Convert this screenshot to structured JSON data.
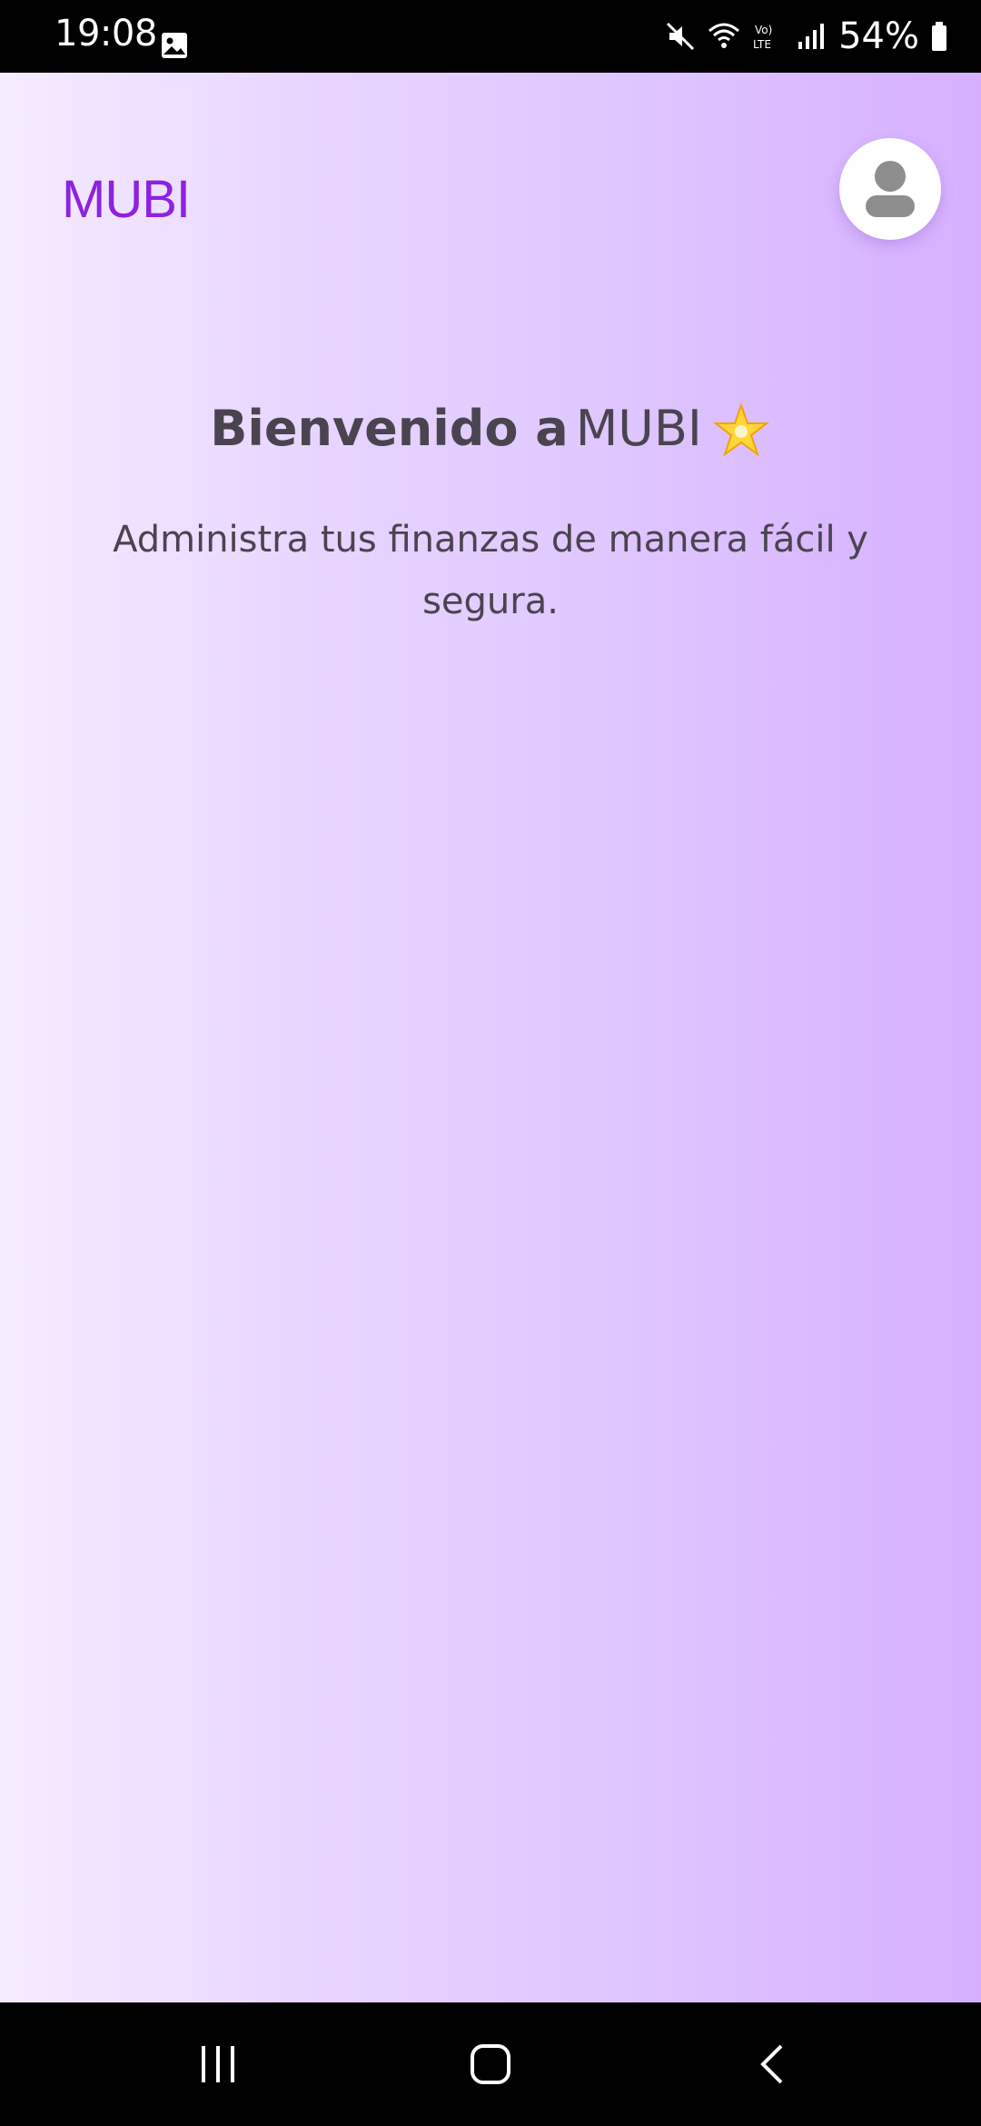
{
  "status_bar": {
    "time": "19:08",
    "battery": "54%",
    "icons": [
      "gallery-icon",
      "mute-icon",
      "wifi-icon",
      "volte-icon",
      "signal-icon",
      "battery-icon"
    ]
  },
  "app": {
    "logo": "MUBI",
    "profile_icon": "user-avatar-icon",
    "welcome_prefix": "Bienvenido a",
    "welcome_brand": "MUBI",
    "welcome_emoji": "star-icon",
    "subtitle": "Administra tus finanzas de manera fácil y segura.",
    "colors": {
      "brand": "#8d22e0",
      "text": "#4a4450",
      "gradient_start": "#f6ecff",
      "gradient_end": "#d6b0ff"
    }
  },
  "nav_bar": {
    "buttons": [
      "recent-apps-button",
      "home-button",
      "back-button"
    ]
  }
}
